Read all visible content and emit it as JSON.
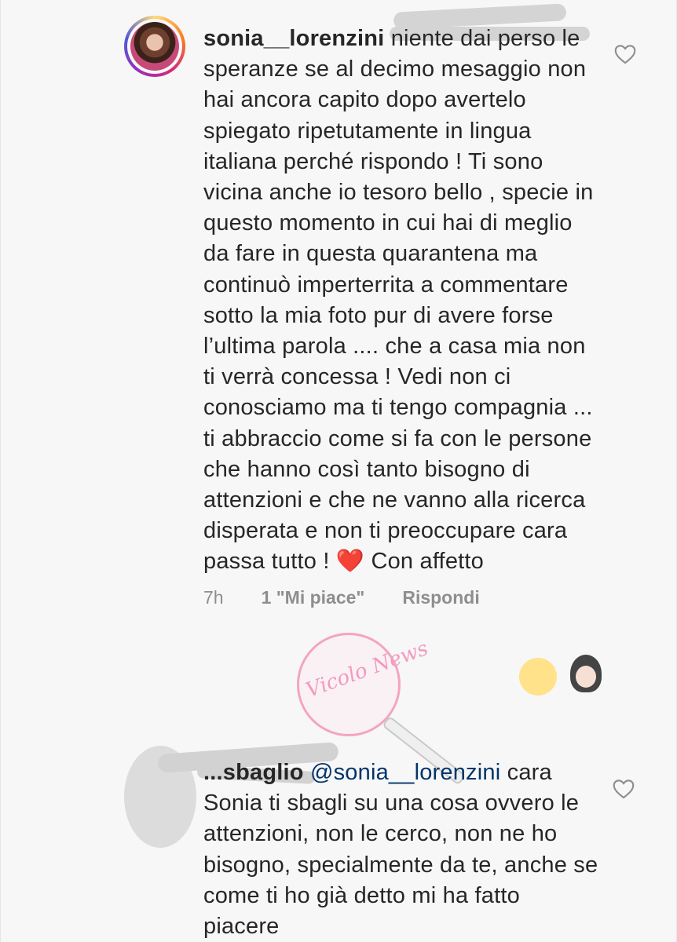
{
  "comment1": {
    "username": "sonia__lorenzini",
    "text": "niente dai perso le speranze se al decimo mesaggio non hai ancora capito dopo avertelo spiegato ripetutamente in lingua italiana perché rispondo ! Ti sono vicina anche io tesoro bello , specie in questo momento in cui hai di meglio da fare in questa quarantena ma continuò imperterrita a commentare sotto la mia foto pur di avere forse l’ultima parola .... che a casa mia non ti verrà concessa ! Vedi non ci conosciamo ma ti tengo compagnia ... ti abbraccio come si fa con le persone che hanno così tanto bisogno di attenzioni e che ne vanno alla ricerca disperata e non ti preoccupare cara passa tutto !",
    "emoji": "❤️",
    "text_after_emoji": "Con affetto",
    "time": "7h",
    "likes": "1 \"Mi piace\"",
    "reply_label": "Rispondi"
  },
  "comment2": {
    "username_partial": "...sbaglio",
    "mention": "@sonia__lorenzini",
    "text": "cara Sonia ti sbagli su una cosa ovvero le attenzioni, non le cerco, non ne ho bisogno, specialmente da te, anche se come ti ho già detto mi ha fatto piacere"
  },
  "watermark": {
    "text": "Vicolo News"
  },
  "icons": {
    "like": "heart-outline-icon",
    "color_like": "#8e8e8e",
    "color_heart": "#d9232e",
    "color_mention": "#003569"
  }
}
